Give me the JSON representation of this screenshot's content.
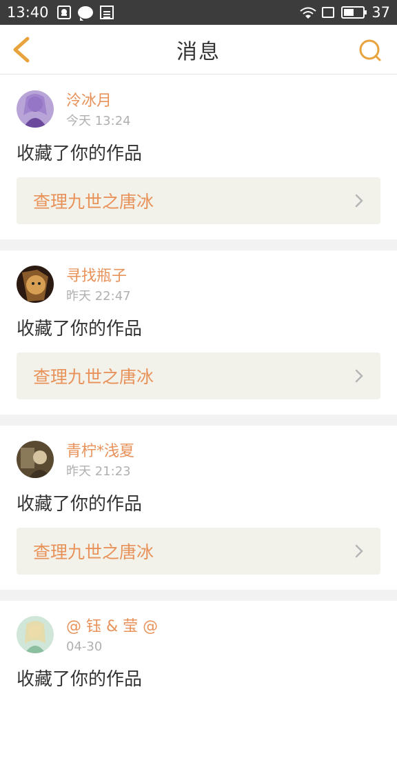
{
  "status_bar": {
    "time": "13:40",
    "battery": "37",
    "left_icons": [
      "qq-icon",
      "message-icon",
      "news-icon"
    ],
    "right_icons": [
      "wifi-icon",
      "screen-icon",
      "battery-icon"
    ]
  },
  "header": {
    "title": "消息",
    "back_icon": "back-chevron-icon",
    "search_icon": "search-icon",
    "accent": "#e8a33c"
  },
  "messages": [
    {
      "username": "泠冰月",
      "time": "今天 13:24",
      "action": "收藏了你的作品",
      "work": "查理九世之唐冰"
    },
    {
      "username": "寻找瓶子",
      "time": "昨天 22:47",
      "action": "收藏了你的作品",
      "work": "查理九世之唐冰"
    },
    {
      "username": "青柠*浅夏",
      "time": "昨天 21:23",
      "action": "收藏了你的作品",
      "work": "查理九世之唐冰"
    },
    {
      "username": "@ 钰 & 莹 @",
      "time": "04-30",
      "action": "收藏了你的作品"
    }
  ],
  "colors": {
    "accent_text": "#e8925a",
    "link_bg": "#f2f2ea",
    "separator": "#f2f2f2"
  }
}
